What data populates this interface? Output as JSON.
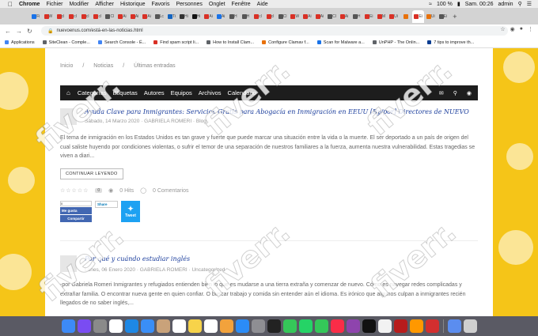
{
  "menubar": {
    "items": [
      "Chrome",
      "Fichier",
      "Modifier",
      "Afficher",
      "Historique",
      "Favoris",
      "Personnes",
      "Onglet",
      "Fenêtre",
      "Aide"
    ],
    "battery": "100 %",
    "clock": "Sam. 00:26",
    "user": "admin"
  },
  "tabs": [
    {
      "label": "Fi",
      "color": "#1a73e8"
    },
    {
      "label": "W",
      "color": "#d93025"
    },
    {
      "label": "cl",
      "color": "#d93025"
    },
    {
      "label": "cl",
      "color": "#d93025"
    },
    {
      "label": "cl",
      "color": "#d93025"
    },
    {
      "label": "cl",
      "color": "#d93025"
    },
    {
      "label": "Cl",
      "color": "#555555"
    },
    {
      "label": "Ai",
      "color": "#d93025"
    },
    {
      "label": "Ai",
      "color": "#d93025"
    },
    {
      "label": "Ai",
      "color": "#d93025"
    },
    {
      "label": "Lc",
      "color": "#555555"
    },
    {
      "label": "Ti",
      "color": "#1565c0"
    },
    {
      "label": "Hi",
      "color": "#333333"
    },
    {
      "label": "Hi",
      "color": "#111111"
    },
    {
      "label": "Ai",
      "color": "#d93025"
    },
    {
      "label": "Ai",
      "color": "#1a73e8"
    },
    {
      "label": "H",
      "color": "#555555"
    },
    {
      "label": "H",
      "color": "#555555"
    },
    {
      "label": "cl",
      "color": "#d93025"
    },
    {
      "label": "cl",
      "color": "#d93025"
    },
    {
      "label": "Cl",
      "color": "#555555"
    },
    {
      "label": "W",
      "color": "#d93025"
    },
    {
      "label": "Ai",
      "color": "#d93025"
    },
    {
      "label": "Ai",
      "color": "#d93025"
    },
    {
      "label": "Cl",
      "color": "#555555"
    },
    {
      "label": "Ai",
      "color": "#d93025"
    },
    {
      "label": "H",
      "color": "#555555"
    },
    {
      "label": "Ei",
      "color": "#d93025"
    },
    {
      "label": "M",
      "color": "#d93025"
    },
    {
      "label": "Ui",
      "color": "#d93025"
    },
    {
      "label": "",
      "color": "#e8710a"
    },
    {
      "label": "Ei",
      "color": "#d93025"
    },
    {
      "label": "Ui",
      "color": "#e8710a"
    },
    {
      "label": "Ei",
      "color": "#555555"
    }
  ],
  "address": {
    "url": "nuevoenus.com/está-en-las-noticias.html"
  },
  "bookmarks": [
    {
      "label": "Applications",
      "color": "#4285f4"
    },
    {
      "label": "SiteClean - Comple...",
      "color": "#5f6368"
    },
    {
      "label": "Search Console - É...",
      "color": "#4285f4"
    },
    {
      "label": "Find spam script li...",
      "color": "#d93025"
    },
    {
      "label": "How to Install Clam...",
      "color": "#5f6368"
    },
    {
      "label": "Configure Clamav f...",
      "color": "#e8710a"
    },
    {
      "label": "Scan for Malware a...",
      "color": "#1a73e8"
    },
    {
      "label": "UnPHP - The Onlin...",
      "color": "#5f6368"
    },
    {
      "label": "7 tips to improve th...",
      "color": "#0b3d91"
    }
  ],
  "breadcrumb": {
    "home": "Inicio",
    "section": "Noticias",
    "separator": "/",
    "current": "Últimas entradas"
  },
  "nav": {
    "items": [
      "Categorías",
      "Etiquetas",
      "Autores",
      "Equipos",
      "Archivos",
      "Calendario"
    ]
  },
  "posts": [
    {
      "title": "Ayuda Clave para Inmigrantes: Servicios Gratis para Abogacía en Inmigración en EEUU [By/por] Directores de NUEVO",
      "meta": "Sábado, 14 Marzo 2020 · GABRIELA ROMERI · Blog",
      "excerpt": "El tema de inmigración en los Estados Unidos es tan grave y fuerte que puede marcar una situación entre la vida o la muerte. El ser deportado a un país de origen del cual saliste huyendo por condiciones violentas, o sufrir el temor de una separación de nuestros familiares a la fuerza, aumenta nuestra vulnerabilidad. Estas tragedias se viven a diari...",
      "button": "CONTINUAR LEYENDO",
      "rating_count": "0",
      "hits": "0 Hits",
      "comments": "0 Comentarios"
    },
    {
      "title": "Por qué y cuándo estudiar inglés",
      "meta": "Lunes, 06 Enero 2020 · GABRIELA ROMERI · Uncategorized",
      "excerpt": "-por Gabriela Romeri Inmigrantes y refugiados entienden bien lo que es mudarse a una tierra extraña y comenzar de nuevo. Cómo es navegar redes complicadas y extrañar familia. O encontrar nueva gente en quien confiar. O buscar trabajo y comida sin entender aún el idioma. Es irónico que algunos culpan a inmigrantes recién llegados de no saber inglés,..."
    }
  ],
  "social": {
    "fb_count": "0",
    "fb_like": "Me gusta",
    "fb_share": "Compartir",
    "li_share": "Share",
    "tweet": "Tweet"
  },
  "watermark": "fiverr.",
  "colors": {
    "page_bg": "#f5c518",
    "nav_bg": "#1d1d1d",
    "title": "#1a3d9c"
  },
  "dock": {
    "icons": [
      "finder-icon",
      "siri-icon",
      "launchpad-icon",
      "chrome-icon",
      "safari-icon",
      "mail-icon",
      "contacts-icon",
      "calendar-icon",
      "notes-icon",
      "reminders-icon",
      "photos-icon",
      "appstore-icon",
      "preferences-icon",
      "terminal-icon",
      "messages-icon",
      "whatsapp-icon",
      "facetime-icon",
      "music-icon",
      "podcasts-icon",
      "tv-icon",
      "news-icon",
      "filezilla-icon",
      "sublime-icon",
      "acrobat-icon",
      "downloads-icon",
      "trash-icon"
    ],
    "colors": [
      "#3d8af7",
      "#7a4cf2",
      "#8a8a8a",
      "#ffffff",
      "#1e88e5",
      "#3a8ef6",
      "#c9a27a",
      "#ffffff",
      "#f7d34a",
      "#ffffff",
      "#f2a23c",
      "#2b8cf7",
      "#8e8e93",
      "#222222",
      "#35c759",
      "#25d366",
      "#34c759",
      "#fa2d48",
      "#8e44ad",
      "#111111",
      "#f2f2f2",
      "#b71c1c",
      "#ff9800",
      "#d32f2f",
      "#5b8def",
      "#cfcfcf"
    ]
  }
}
